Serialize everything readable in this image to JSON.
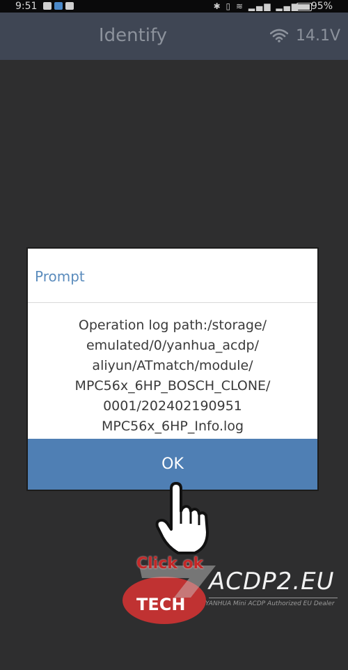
{
  "status_bar": {
    "time": "9:51",
    "battery": "95%"
  },
  "header": {
    "title": "Identify",
    "voltage": "14.1V"
  },
  "dialog": {
    "title": "Prompt",
    "message_lines": [
      "Operation log path:/storage/",
      "emulated/0/yanhua_acdp/",
      "aliyun/ATmatch/module/",
      "MPC56x_6HP_BOSCH_CLONE/",
      "0001/202402190951",
      "MPC56x_6HP_Info.log"
    ],
    "ok_label": "OK"
  },
  "overlay": {
    "caption": "Click ok",
    "watermark": {
      "logo": "TECH",
      "site": "ACDP2.EU",
      "tagline": "YANHUA Mini ACDP Authorized EU Dealer"
    }
  },
  "colors": {
    "header_bg": "#3f4654",
    "screen_bg": "#2e2e2f",
    "accent": "#4f7fb4",
    "prompt_title": "#5b8cbd",
    "caption": "#c42828"
  },
  "icons": [
    "video-icon",
    "gallery-icon",
    "sim-icon",
    "bluetooth-icon",
    "vibrate-icon",
    "wifi-icon",
    "signal-icon",
    "battery-icon",
    "hand-pointer-icon"
  ]
}
